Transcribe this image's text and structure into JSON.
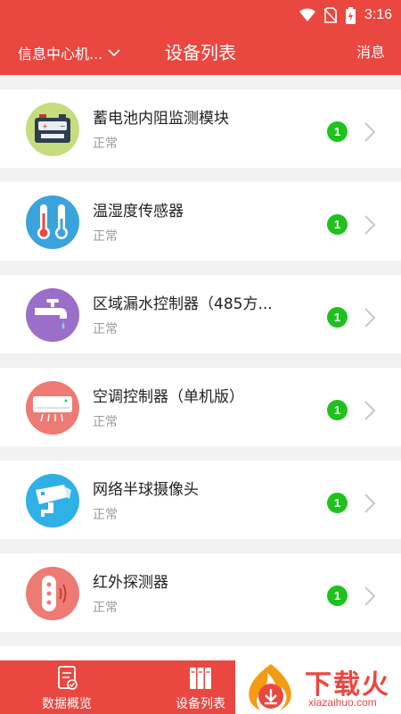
{
  "colors": {
    "primary": "#e9473f",
    "badge": "#1fc21c"
  },
  "status_bar": {
    "time": "3:16"
  },
  "app_bar": {
    "left_label": "信息中心机...",
    "title": "设备列表",
    "right_label": "消息"
  },
  "devices": [
    {
      "name": "蓄电池内阻监测模块",
      "status": "正常",
      "count": "1",
      "icon": "battery-icon"
    },
    {
      "name": "温湿度传感器",
      "status": "正常",
      "count": "1",
      "icon": "thermometer-icon"
    },
    {
      "name": "区域漏水控制器（485方...",
      "status": "正常",
      "count": "1",
      "icon": "water-faucet-icon"
    },
    {
      "name": "空调控制器（单机版）",
      "status": "正常",
      "count": "1",
      "icon": "air-conditioner-icon"
    },
    {
      "name": "网络半球摄像头",
      "status": "正常",
      "count": "1",
      "icon": "camera-icon"
    },
    {
      "name": "红外探测器",
      "status": "正常",
      "count": "1",
      "icon": "infrared-sensor-icon"
    }
  ],
  "bottom_nav": [
    {
      "label": "数据概览",
      "icon": "report-icon"
    },
    {
      "label": "设备列表",
      "icon": "device-list-icon"
    }
  ],
  "watermark": {
    "text": "下载火",
    "url": "xiazaihuo.com"
  }
}
